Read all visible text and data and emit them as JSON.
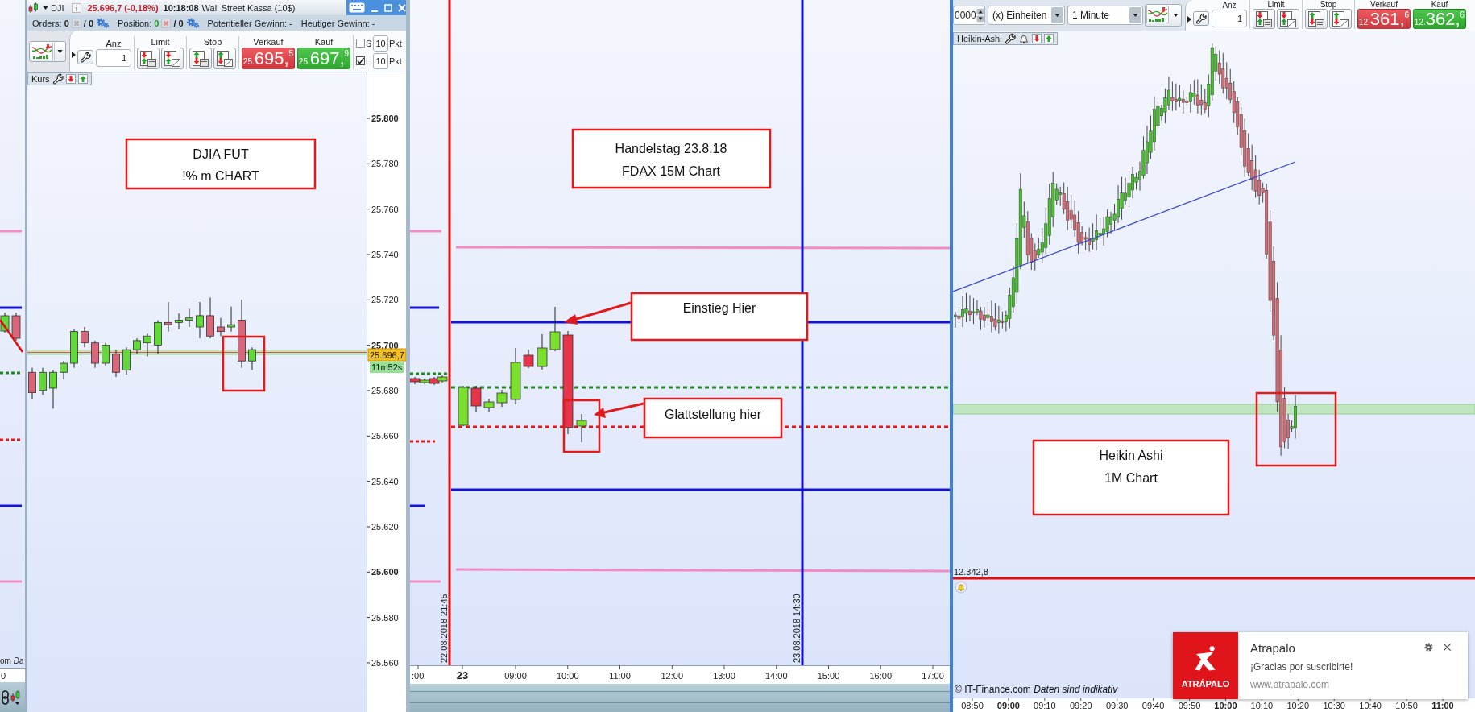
{
  "side_window": {
    "footer": "om *Da*",
    "axis_label": "0"
  },
  "left_window": {
    "title_bar": {
      "symbol": "DJI",
      "quote": "25.696,7 (-0,18%)",
      "time": "10:18:08",
      "instrument": "Wall Street Kassa (10$)"
    },
    "account_bar": {
      "orders_label": "Orders:",
      "orders_open": "0",
      "orders_total": "/ 0",
      "position_label": "Position:",
      "position_open": "0",
      "position_total": "/ 0",
      "potential_gain": "Potentieller Gewinn: -",
      "daily_gain": "Heutiger Gewinn: -"
    },
    "order_panel": {
      "quantity_label": "Anz",
      "quantity": "1",
      "limit_label": "Limit",
      "stop_label": "Stop",
      "sell": {
        "label": "Verkauf",
        "prefix": "25.",
        "main": "695,",
        "fraction": "5"
      },
      "buy": {
        "label": "Kauf",
        "prefix": "25.",
        "main": "697,",
        "fraction": "9"
      },
      "offsets": [
        {
          "label": "S",
          "checked": false,
          "points": "10",
          "unit": "Pkt"
        },
        {
          "label": "L",
          "checked": true,
          "points": "10",
          "unit": "Pkt"
        }
      ]
    },
    "chart": {
      "tab_label": "Kurs",
      "note": [
        "DJIA FUT",
        "!% m CHART"
      ],
      "price_ticks": [
        {
          "label": "25.800",
          "major": true
        },
        {
          "label": "25.780",
          "major": false
        },
        {
          "label": "25.760",
          "major": false
        },
        {
          "label": "25.740",
          "major": false
        },
        {
          "label": "25.720",
          "major": false
        },
        {
          "label": "25.700",
          "major": true
        },
        {
          "label": "25.680",
          "major": false
        },
        {
          "label": "25.660",
          "major": false
        },
        {
          "label": "25.640",
          "major": false
        },
        {
          "label": "25.620",
          "major": false
        },
        {
          "label": "25.600",
          "major": true
        },
        {
          "label": "25.580",
          "major": false
        },
        {
          "label": "25.560",
          "major": false
        }
      ],
      "last_price": "25.696,7",
      "countdown": "11m52s"
    }
  },
  "middle_window": {
    "chart": {
      "note": [
        "Handelstag 23.8.18",
        "FDAX 15M Chart"
      ],
      "callouts": [
        {
          "text": "Einstieg Hier"
        },
        {
          "text": "Glattstellung hier"
        }
      ],
      "marker_labels": [
        "22.08.2018 21:45",
        "23.08.2018 14:30"
      ],
      "time_ticks": [
        {
          "label": ":00",
          "major": false
        },
        {
          "label": "23",
          "major": true
        },
        {
          "label": "09:00",
          "major": false
        },
        {
          "label": "10:00",
          "major": false
        },
        {
          "label": "11:00",
          "major": false
        },
        {
          "label": "12:00",
          "major": false
        },
        {
          "label": "13:00",
          "major": false
        },
        {
          "label": "14:00",
          "major": false
        },
        {
          "label": "15:00",
          "major": false
        },
        {
          "label": "16:00",
          "major": false
        },
        {
          "label": "17:00",
          "major": false
        }
      ]
    }
  },
  "right_window": {
    "toolbar": {
      "amount": "0000",
      "unit_select": "(x) Einheiten",
      "interval_select": "1 Minute",
      "quantity_label": "Anz",
      "quantity": "1",
      "limit_label": "Limit",
      "stop_label": "Stop",
      "sell": {
        "label": "Verkauf",
        "prefix": "12.",
        "main": "361,",
        "fraction": "6"
      },
      "buy": {
        "label": "Kauf",
        "prefix": "12.",
        "main": "362,",
        "fraction": "6"
      }
    },
    "chart": {
      "tab_label": "Heikin-Ashi",
      "note": [
        "Heikin Ashi",
        "1M Chart"
      ],
      "alert_price": "12.342,8",
      "footer": "© IT-Finance.com *Daten sind indikativ*",
      "time_ticks": [
        {
          "label": "08:50",
          "major": false
        },
        {
          "label": "09:00",
          "major": true
        },
        {
          "label": "09:10",
          "major": false
        },
        {
          "label": "09:20",
          "major": false
        },
        {
          "label": "09:30",
          "major": false
        },
        {
          "label": "09:40",
          "major": false
        },
        {
          "label": "09:50",
          "major": false
        },
        {
          "label": "10:00",
          "major": true
        },
        {
          "label": "10:10",
          "major": false
        },
        {
          "label": "10:20",
          "major": false
        },
        {
          "label": "10:30",
          "major": false
        },
        {
          "label": "10:40",
          "major": false
        },
        {
          "label": "10:50",
          "major": false
        },
        {
          "label": "11:00",
          "major": true
        }
      ]
    }
  },
  "notification": {
    "logo_text": "ATRÁPALO",
    "title": "Atrapalo",
    "message": "¡Gracias por suscribirte!",
    "url": "www.atrapalo.com"
  }
}
